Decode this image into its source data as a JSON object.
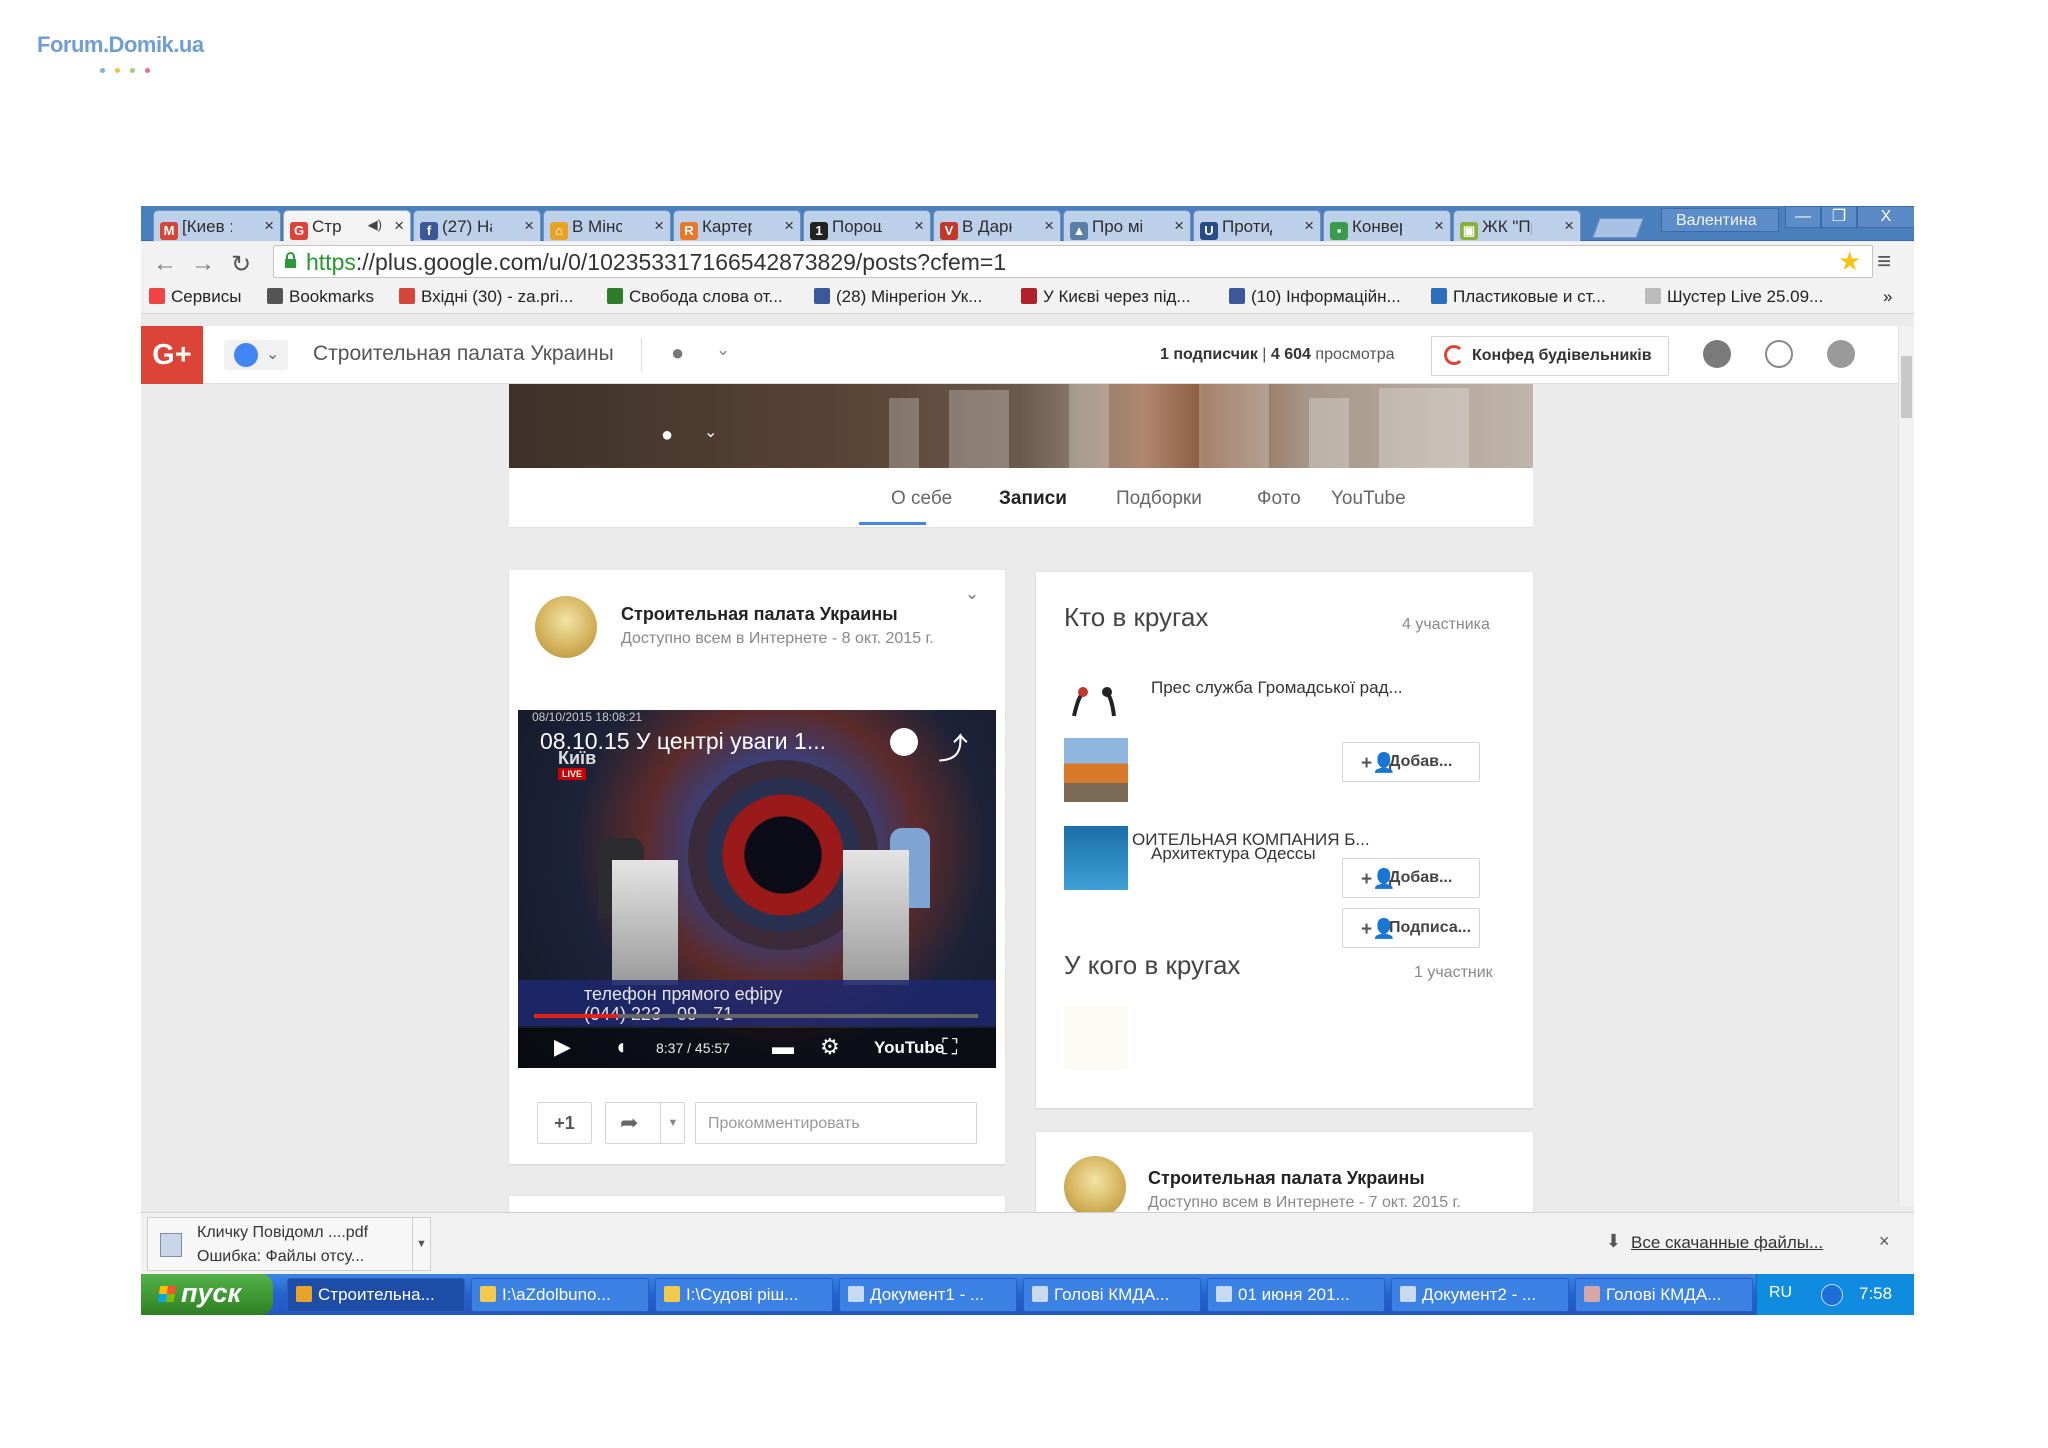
{
  "watermark": {
    "text": "Forum.Domik.ua",
    "dot_colors": [
      "#7fb0e0",
      "#f5c23c",
      "#9bd06e",
      "#e86aa8"
    ]
  },
  "browser": {
    "tabs": [
      {
        "label": "[Киев :",
        "icon": "gmail-icon",
        "color": "#d44638",
        "glyph": "M"
      },
      {
        "label": "Стр",
        "icon": "google-plus-icon",
        "color": "#db4437",
        "glyph": "G",
        "active": true,
        "audio": true
      },
      {
        "label": "(27) На",
        "icon": "facebook-icon",
        "color": "#3b5998",
        "glyph": "f"
      },
      {
        "label": "В Мінс",
        "icon": "home-icon",
        "color": "#e7a326",
        "glyph": "⌂"
      },
      {
        "label": "Картер",
        "icon": "news-icon",
        "color": "#e8792b",
        "glyph": "R"
      },
      {
        "label": "Порош",
        "icon": "channel-icon",
        "color": "#222",
        "glyph": "1"
      },
      {
        "label": "В Дарн",
        "icon": "news-v-icon",
        "color": "#c0392b",
        "glyph": "V"
      },
      {
        "label": "Про мі",
        "icon": "building-icon",
        "color": "#5a7ea8",
        "glyph": "▲"
      },
      {
        "label": "Протид",
        "icon": "shield-icon",
        "color": "#2a4c86",
        "glyph": "U"
      },
      {
        "label": "Конвер",
        "icon": "doc-icon",
        "color": "#3a9a4e",
        "glyph": "▪"
      },
      {
        "label": "ЖК \"Пр",
        "icon": "zhk-icon",
        "color": "#88b03a",
        "glyph": "▣"
      }
    ],
    "tab_close": "×",
    "user": "Валентина",
    "window_controls": {
      "minimize": "—",
      "restore": "❐",
      "close": "X"
    },
    "url_https": "https",
    "url_rest": "://plus.google.com/u/0/102353317166542873829/posts?cfem=1",
    "bookmarks": [
      {
        "label": "Сервисы",
        "icon": "apps-icon",
        "color": "#e44"
      },
      {
        "label": "Bookmarks",
        "icon": "star-icon",
        "color": "#555"
      },
      {
        "label": "Вхідні (30) - za.pri...",
        "icon": "gmail-icon",
        "color": "#d44638"
      },
      {
        "label": "Свобода слова от...",
        "icon": "video-icon",
        "color": "#2d7d2d"
      },
      {
        "label": "(28) Мінрегіон Ук...",
        "icon": "facebook-icon",
        "color": "#3b5998"
      },
      {
        "label": "У Києві через під...",
        "icon": "news-k-icon",
        "color": "#b2222b"
      },
      {
        "label": "(10) Інформаційн...",
        "icon": "facebook-icon",
        "color": "#3b5998"
      },
      {
        "label": "Пластиковые и ст...",
        "icon": "drive-icon",
        "color": "#2d6fbf"
      },
      {
        "label": "Шустер Live 25.09...",
        "icon": "page-icon",
        "color": "#bbb"
      }
    ],
    "bookmarks_more": "»"
  },
  "gplus": {
    "logo": "G+",
    "page_name": "Строительная палата Украины",
    "stats": {
      "followers": "1 подписчик",
      "sep": "|",
      "views": "4 604",
      "views_label": "просмотра"
    },
    "company_button": "Конфед будівельників"
  },
  "profile_tabs": [
    {
      "label": "О себе"
    },
    {
      "label": "Записи",
      "active": true
    },
    {
      "label": "Подборки"
    },
    {
      "label": "Фото"
    },
    {
      "label": "YouTube"
    }
  ],
  "post": {
    "author": "Строительная палата Украины",
    "visibility": "Доступно всем в Интернете",
    "meta_sep": "-",
    "date": "8 окт. 2015 г.",
    "video": {
      "title": "08.10.15 У центрі уваги 1...",
      "stamp": "08/10/2015 18:08:21",
      "channel": "Київ",
      "live": "LIVE",
      "strap_line1": "телефон прямого ефіру",
      "strap_line2": "(044) 223 - 09 - 71",
      "time": "8:37 / 45:57",
      "yt": "YouTube",
      "progress": 0.19
    },
    "plus_one": "+1",
    "comment_placeholder": "Прокомментировать"
  },
  "circles": {
    "in_circles_title": "Кто в кругах",
    "in_circles_count": "4 участника",
    "members": [
      {
        "name": "Прес служба Громадської рад..."
      },
      {
        "name": "",
        "button": "Добав..."
      },
      {
        "name": "ОИТЕЛЬНАЯ КОМПАНИЯ Б...",
        "name2": "Архитектура Одессы",
        "button": "Добав...",
        "button2": "Подписа..."
      }
    ],
    "has_you_title": "У кого в кругах",
    "has_you_count": "1 участник"
  },
  "post2": {
    "author": "Строительная палата Украины",
    "visibility": "Доступно всем в Интернете",
    "meta_sep": "-",
    "date": "7 окт. 2015 г."
  },
  "downloads": {
    "file": "Кличку Повідомл ....pdf",
    "error": "Ошибка: Файлы отсу...",
    "all": "Все скачанные файлы...",
    "close": "×"
  },
  "taskbar": {
    "start": "пуск",
    "items": [
      {
        "label": "Строительна...",
        "icon": "chrome-icon",
        "active": true
      },
      {
        "label": "I:\\aZdolbuno...",
        "icon": "folder-icon"
      },
      {
        "label": "I:\\Судові ріш...",
        "icon": "folder-icon"
      },
      {
        "label": "Документ1 - ...",
        "icon": "word-icon"
      },
      {
        "label": "Голові КМДА...",
        "icon": "word-icon"
      },
      {
        "label": "01 июня 201...",
        "icon": "word-icon"
      },
      {
        "label": "Документ2 - ...",
        "icon": "word-icon"
      },
      {
        "label": "Голові КМДА...",
        "icon": "image-icon"
      }
    ],
    "lang": "RU",
    "clock": "7:58"
  }
}
